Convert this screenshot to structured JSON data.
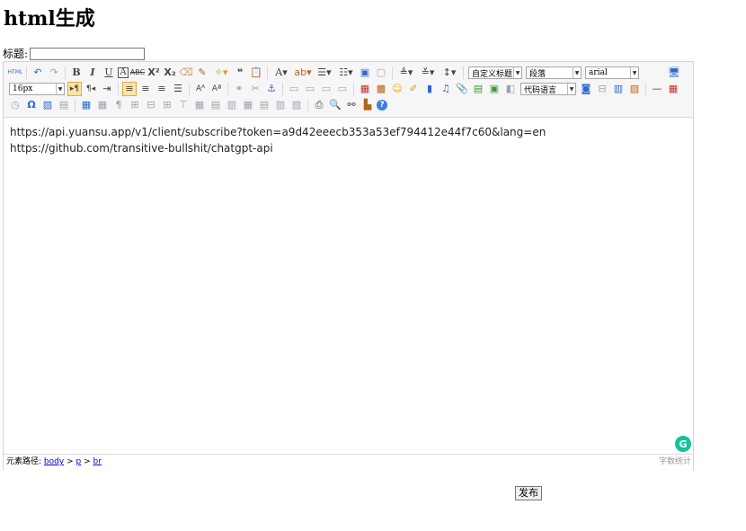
{
  "page": {
    "title": "html生成"
  },
  "form": {
    "title_label": "标题:",
    "title_value": "",
    "submit_label": "发布"
  },
  "toolbar": {
    "source_label": "HTML",
    "heading_select": "自定义标题",
    "paragraph_select": "段落",
    "font_family_select": "arial",
    "font_size_select": "16px",
    "code_language_select": "代码语言",
    "icons_row1": [
      "source-icon",
      "undo-icon",
      "redo-icon",
      "bold-icon",
      "italic-icon",
      "underline-icon",
      "font-border-icon",
      "strikethrough-icon",
      "superscript-icon",
      "subscript-icon",
      "remove-format-icon",
      "format-match-icon",
      "auto-typeset-icon",
      "blockquote-icon",
      "paste-plain-icon",
      "fore-color-icon",
      "back-color-icon",
      "ordered-list-icon",
      "unordered-list-icon",
      "select-all-icon",
      "clear-doc-icon",
      "row-spacing-top-icon",
      "row-spacing-bottom-icon",
      "line-height-icon",
      "preview-icon"
    ],
    "icons_row2": [
      "ltr-icon",
      "rtl-icon",
      "indent-icon",
      "justify-left-icon",
      "justify-center-icon",
      "justify-right-icon",
      "justify-justify-icon",
      "uppercase-icon",
      "lowercase-icon",
      "link-icon",
      "unlink-icon",
      "anchor-icon",
      "image-none-icon",
      "image-left-icon",
      "image-right-icon",
      "image-center-icon",
      "simple-upload-icon",
      "insert-image-icon",
      "emotion-icon",
      "scrawl-icon",
      "insert-video-icon",
      "music-icon",
      "attachment-icon",
      "map-icon",
      "gmap-icon",
      "insert-frame-icon",
      "insert-code-icon",
      "page-break-icon",
      "template-icon",
      "background-icon",
      "horizontal-icon",
      "date-icon"
    ],
    "icons_row3": [
      "time-icon",
      "special-chars-icon",
      "snapscreen-icon",
      "wordimage-icon",
      "insert-table-icon",
      "delete-table-icon",
      "insert-paragraph-before-table-icon",
      "insert-row-icon",
      "delete-row-icon",
      "insert-col-icon",
      "delete-col-icon",
      "merge-cells-icon",
      "merge-right-icon",
      "merge-down-icon",
      "split-to-cells-icon",
      "split-to-rows-icon",
      "split-to-cols-icon",
      "chart-icon",
      "print-icon",
      "search-replace-icon",
      "drafts-icon",
      "help-icon"
    ]
  },
  "content": {
    "lines": [
      "https://api.yuansu.app/v1/client/subscribe?token=a9d42eeecb353a53ef794412e44f7c60&lang=en",
      "https://github.com/transitive-bullshit/chatgpt-api"
    ]
  },
  "statusbar": {
    "path_label": "元素路径:",
    "path": [
      "body",
      "p",
      "br"
    ],
    "separator": ">",
    "word_count_label": "字数统计"
  },
  "grammarly": {
    "label": "G"
  }
}
